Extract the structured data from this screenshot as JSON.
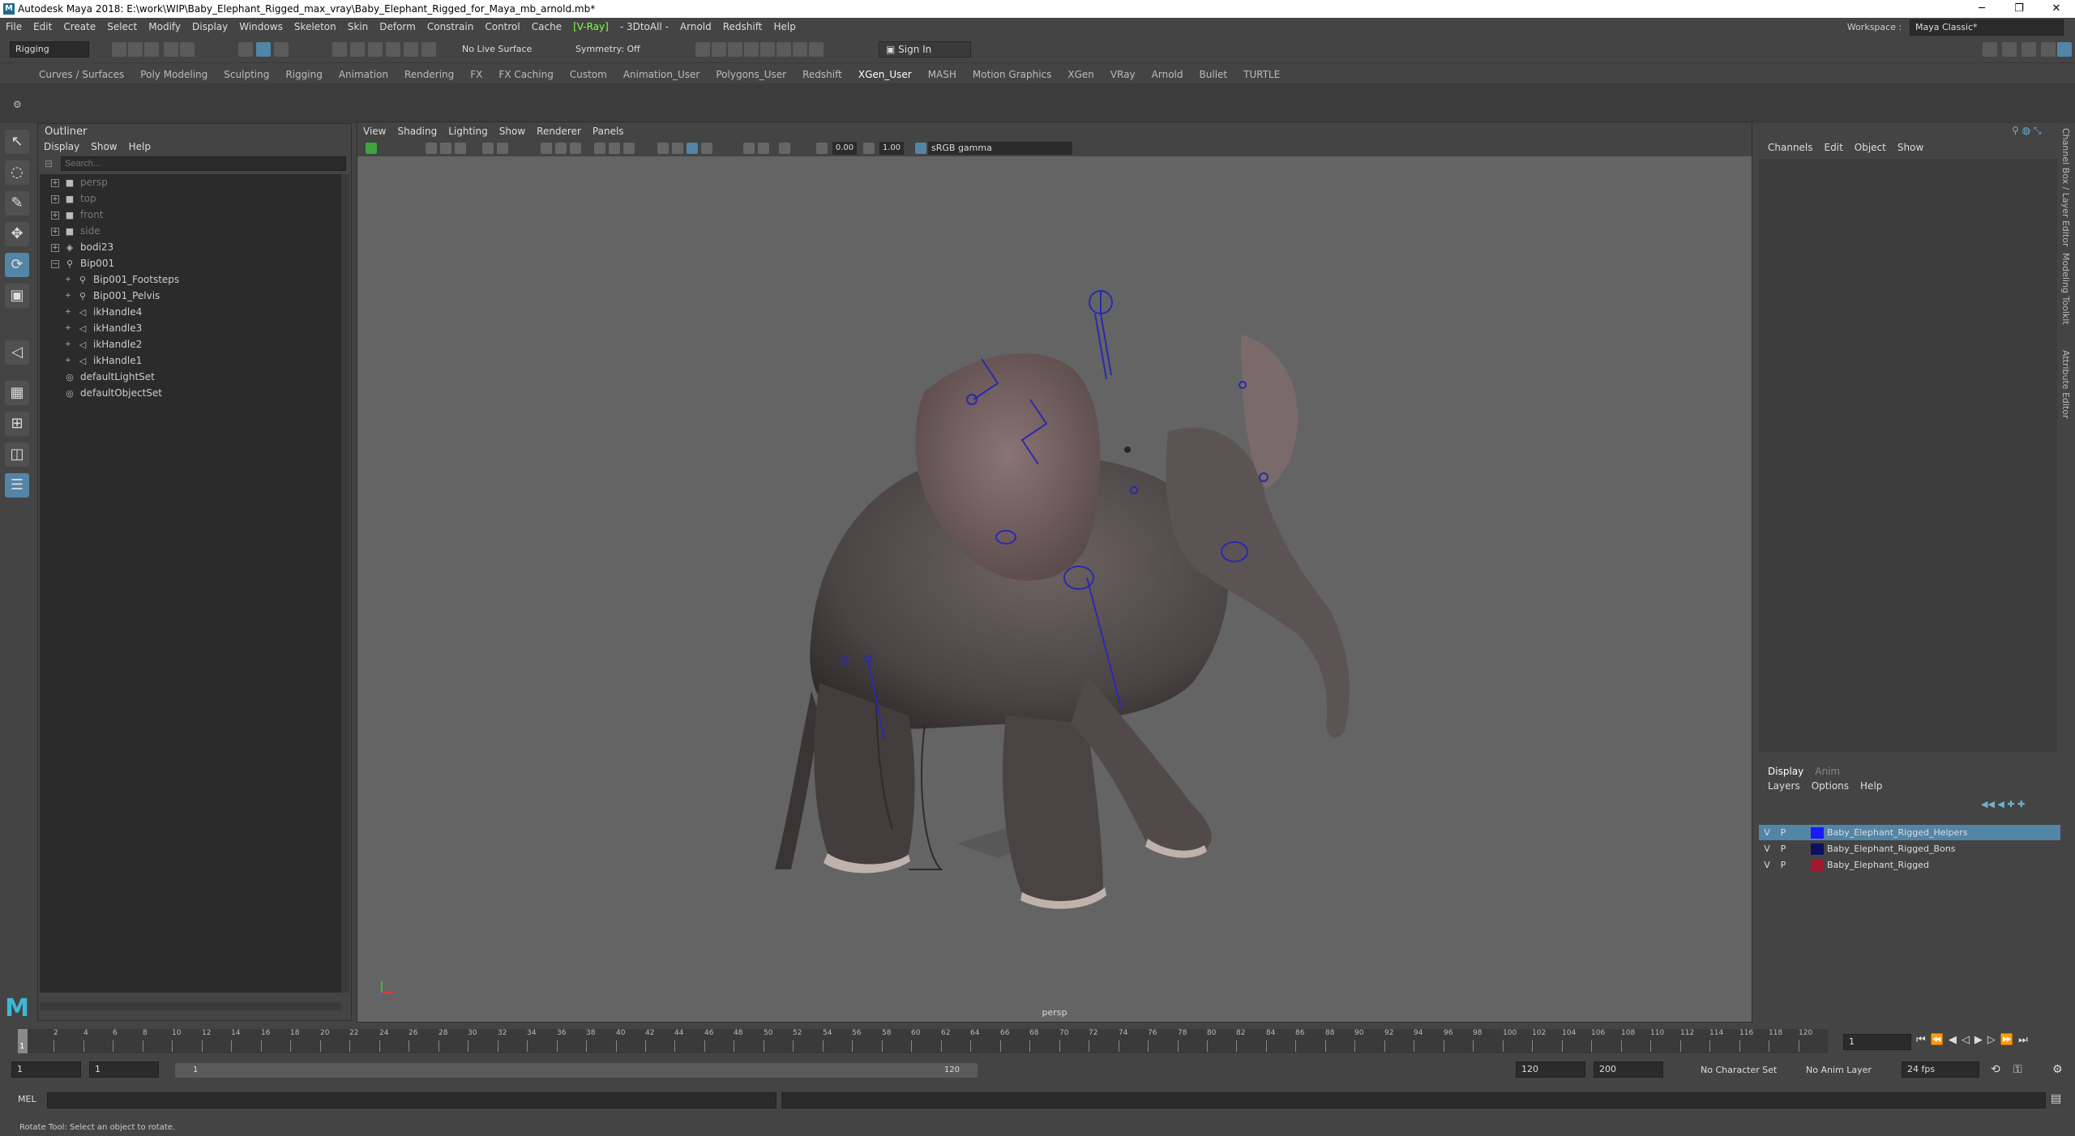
{
  "window": {
    "title": "Autodesk Maya 2018: E:\\work\\WIP\\Baby_Elephant_Rigged_max_vray\\Baby_Elephant_Rigged_for_Maya_mb_arnold.mb*",
    "controls": [
      "─",
      "❐",
      "✕"
    ]
  },
  "menubar": [
    "File",
    "Edit",
    "Create",
    "Select",
    "Modify",
    "Display",
    "Windows",
    "Skeleton",
    "Skin",
    "Deform",
    "Constrain",
    "Control",
    "Cache",
    "[V-Ray]",
    "- 3DtoAll -",
    "Arnold",
    "Redshift",
    "Help"
  ],
  "workspace": {
    "label": "Workspace :",
    "value": "Maya Classic*"
  },
  "toolbar": {
    "mode": "Rigging",
    "live_surface": "No Live Surface",
    "symmetry": "Symmetry: Off",
    "sign_in": "Sign In"
  },
  "shelf_tabs": [
    "Curves / Surfaces",
    "Poly Modeling",
    "Sculpting",
    "Rigging",
    "Animation",
    "Rendering",
    "FX",
    "FX Caching",
    "Custom",
    "Animation_User",
    "Polygons_User",
    "Redshift",
    "XGen_User",
    "MASH",
    "Motion Graphics",
    "XGen",
    "VRay",
    "Arnold",
    "Bullet",
    "TURTLE"
  ],
  "shelf_active": "XGen_User",
  "outliner": {
    "title": "Outliner",
    "menu": [
      "Display",
      "Show",
      "Help"
    ],
    "search_placeholder": "Search...",
    "items": [
      {
        "label": "persp",
        "dim": true,
        "indent": 0,
        "icon": "camera"
      },
      {
        "label": "top",
        "dim": true,
        "indent": 0,
        "icon": "camera"
      },
      {
        "label": "front",
        "dim": true,
        "indent": 0,
        "icon": "camera"
      },
      {
        "label": "side",
        "dim": true,
        "indent": 0,
        "icon": "camera"
      },
      {
        "label": "bodi23",
        "dim": false,
        "indent": 0,
        "icon": "transform"
      },
      {
        "label": "Bip001",
        "dim": false,
        "indent": 0,
        "icon": "joint"
      },
      {
        "label": "Bip001_Footsteps",
        "dim": false,
        "indent": 1,
        "icon": "joint"
      },
      {
        "label": "Bip001_Pelvis",
        "dim": false,
        "indent": 1,
        "icon": "joint"
      },
      {
        "label": "ikHandle4",
        "dim": false,
        "indent": 1,
        "icon": "ik"
      },
      {
        "label": "ikHandle3",
        "dim": false,
        "indent": 1,
        "icon": "ik"
      },
      {
        "label": "ikHandle2",
        "dim": false,
        "indent": 1,
        "icon": "ik"
      },
      {
        "label": "ikHandle1",
        "dim": false,
        "indent": 1,
        "icon": "ik"
      },
      {
        "label": "defaultLightSet",
        "dim": false,
        "indent": 0,
        "icon": "set"
      },
      {
        "label": "defaultObjectSet",
        "dim": false,
        "indent": 0,
        "icon": "set"
      }
    ]
  },
  "viewport": {
    "menu": [
      "View",
      "Shading",
      "Lighting",
      "Show",
      "Renderer",
      "Panels"
    ],
    "exposure": "0.00",
    "gamma": "1.00",
    "color_space": "sRGB gamma",
    "camera_label": "persp"
  },
  "channel_box": {
    "menu": [
      "Channels",
      "Edit",
      "Object",
      "Show"
    ]
  },
  "side_tabs": [
    "Channel Box / Layer Editor",
    "Modeling Toolkit",
    "Attribute Editor"
  ],
  "layer_editor": {
    "tabs": [
      "Display",
      "Anim"
    ],
    "menu": [
      "Layers",
      "Options",
      "Help"
    ],
    "layers": [
      {
        "v": "V",
        "p": "P",
        "name": "Baby_Elephant_Rigged_Helpers",
        "color": "#1a1aff",
        "selected": true
      },
      {
        "v": "V",
        "p": "P",
        "name": "Baby_Elephant_Rigged_Bons",
        "color": "#101060",
        "selected": false
      },
      {
        "v": "V",
        "p": "P",
        "name": "Baby_Elephant_Rigged",
        "color": "#a01830",
        "selected": false
      }
    ]
  },
  "timeline": {
    "ticks": [
      "1",
      "2",
      "4",
      "6",
      "8",
      "10",
      "12",
      "14",
      "16",
      "18",
      "20",
      "22",
      "24",
      "26",
      "28",
      "30",
      "32",
      "34",
      "36",
      "38",
      "40",
      "42",
      "44",
      "46",
      "48",
      "50",
      "52",
      "54",
      "56",
      "58",
      "60",
      "62",
      "64",
      "66",
      "68",
      "70",
      "72",
      "74",
      "76",
      "78",
      "80",
      "82",
      "84",
      "86",
      "88",
      "90",
      "92",
      "94",
      "96",
      "98",
      "100",
      "102",
      "104",
      "106",
      "108",
      "110",
      "112",
      "114",
      "116",
      "118",
      "120"
    ],
    "current_frame": "1"
  },
  "range": {
    "start": "1",
    "anim_start": "1",
    "slider_start": "1",
    "slider_end": "120",
    "end": "120",
    "anim_end": "200",
    "character_set": "No Character Set",
    "anim_layer": "No Anim Layer",
    "fps": "24 fps"
  },
  "command_line": {
    "lang": "MEL"
  },
  "help_line": "Rotate Tool: Select an object to rotate.",
  "colors": {
    "accent": "#5285a6",
    "viewport_bg": "#646464"
  }
}
